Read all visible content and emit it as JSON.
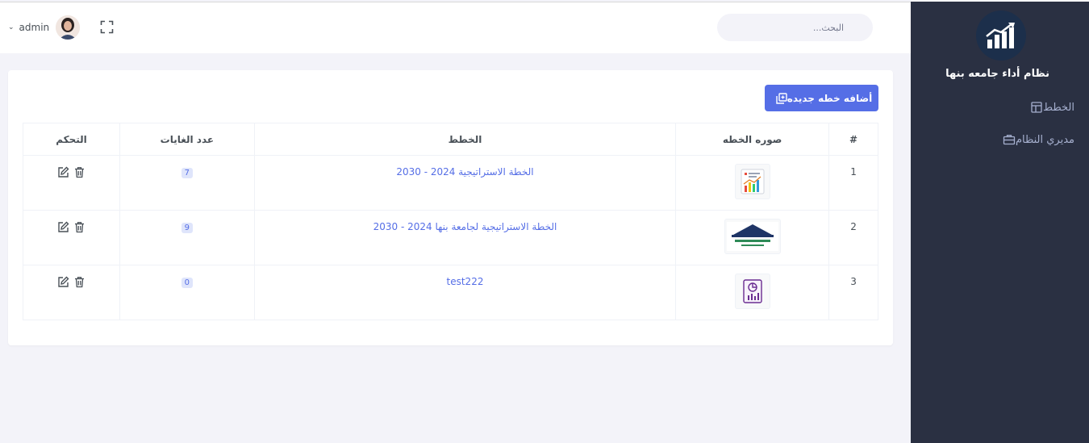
{
  "sidebar": {
    "brand": "نظام أداء جامعه بنها",
    "logo_icon": "growth-chart-icon",
    "items": [
      {
        "label": "الخطط",
        "icon": "layout-icon"
      },
      {
        "label": "مديري النظام",
        "icon": "briefcase-icon"
      }
    ]
  },
  "topbar": {
    "search_placeholder": "البحث...",
    "fullscreen_icon": "fullscreen-icon",
    "user": {
      "name": "admin",
      "avatar_icon": "avatar-icon"
    }
  },
  "toolbar": {
    "add_label": "أضافه خطه جديده"
  },
  "table": {
    "headers": [
      "#",
      "صوره الخطه",
      "الخطط",
      "عدد الغايات",
      "التحكم"
    ],
    "rows": [
      {
        "num": "1",
        "image": "chart-report-icon",
        "plan": "الخطة الاستراتيجية 2024 - 2030",
        "count": "7"
      },
      {
        "num": "2",
        "image": "unit-logo-image",
        "plan": "الخطة الاستراتيجية لجامعة بنها 2024 - 2030",
        "count": "9"
      },
      {
        "num": "3",
        "image": "document-report-icon",
        "plan": "test222",
        "count": "0"
      }
    ]
  },
  "colors": {
    "sidebar_bg": "#2a3042",
    "accent": "#556ee6",
    "page_bg": "#f3f3f9"
  }
}
